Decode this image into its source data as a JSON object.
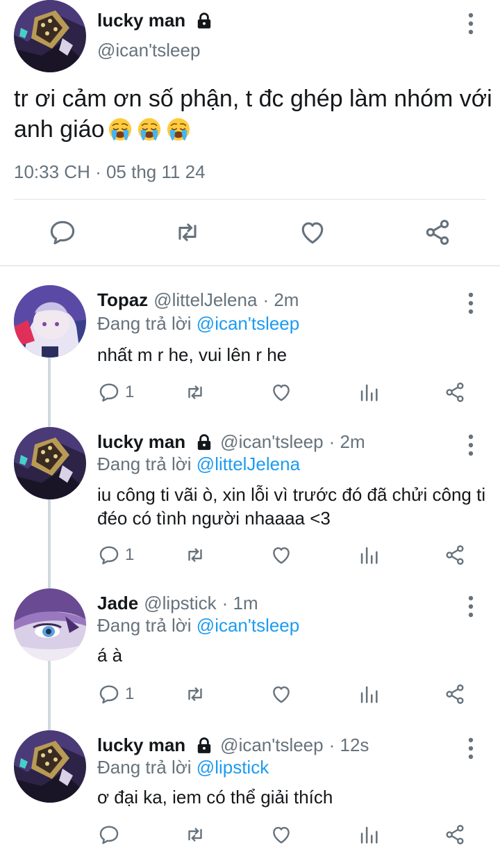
{
  "main_tweet": {
    "display_name": "lucky man",
    "handle": "@ican'tsleep",
    "text": "tr ơi cảm ơn số phận, t đc ghép làm nhóm với anh giáo",
    "emojis": [
      "loudly-crying-face",
      "loudly-crying-face",
      "loudly-crying-face"
    ],
    "timestamp": "10:33 CH · 05 thg 11 24",
    "actions": [
      "reply-icon",
      "retweet-icon",
      "like-icon",
      "share-icon"
    ]
  },
  "replies": [
    {
      "display_name": "Topaz",
      "handle": "@littelJelena",
      "time": "· 2m",
      "replying_label": "Đang trả lời",
      "replying_to": "@ican'tsleep",
      "text": "nhất m r he, vui lên r he",
      "reply_count": "1",
      "locked": false
    },
    {
      "display_name": "lucky man",
      "handle": "@ican'tsleep",
      "time": "· 2m",
      "replying_label": "Đang trả lời",
      "replying_to": "@littelJelena",
      "text": "iu công ti vãi ò, xin lỗi vì trước đó đã chửi công ti đéo có tình người nhaaaa <3",
      "reply_count": "1",
      "locked": true
    },
    {
      "display_name": "Jade",
      "handle": "@lipstick",
      "time": "· 1m",
      "replying_label": "Đang trả lời",
      "replying_to": "@ican'tsleep",
      "text": "á à",
      "reply_count": "1",
      "locked": false
    },
    {
      "display_name": "lucky man",
      "handle": "@ican'tsleep",
      "time": "· 12s",
      "replying_label": "Đang trả lời",
      "replying_to": "@lipstick",
      "text": "ơ đại ka, iem có thể giải thích",
      "reply_count": "",
      "locked": true
    }
  ],
  "colors": {
    "text": "#14171a",
    "secondary": "#66727c",
    "link": "#1d9bf0",
    "thread_line": "#cfd9de"
  }
}
